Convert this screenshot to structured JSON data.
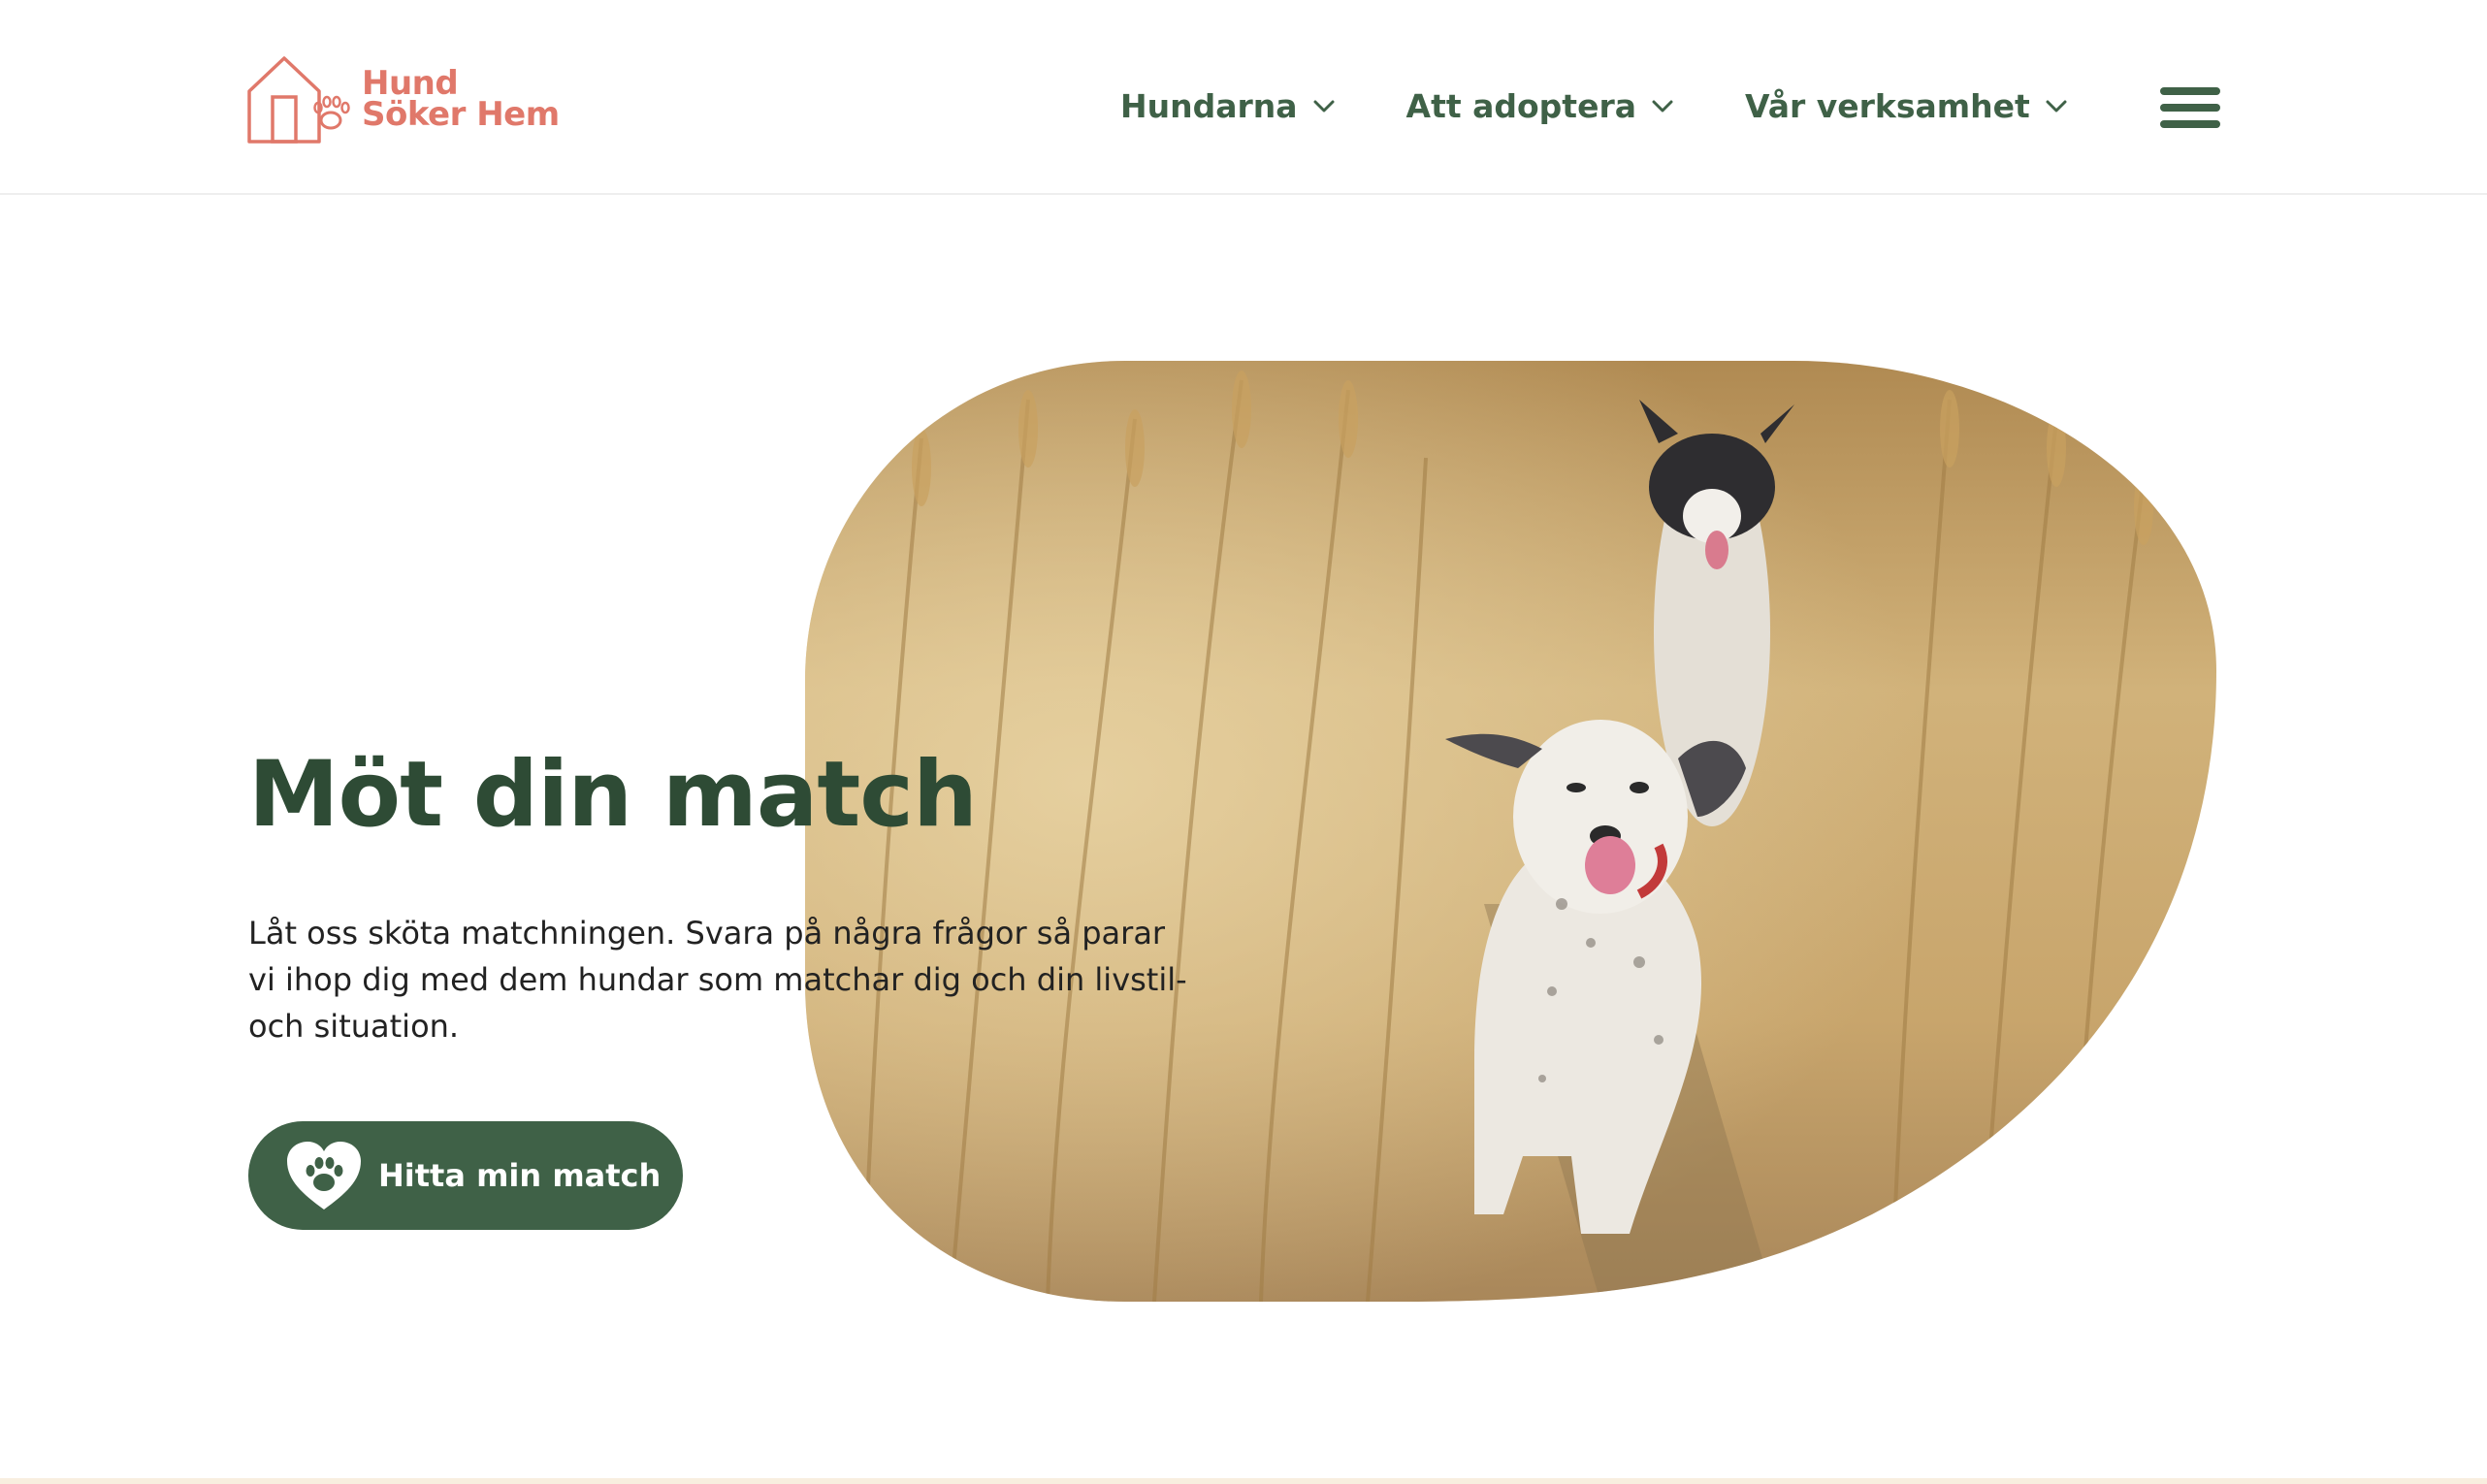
{
  "brand": {
    "line1": "Hund",
    "line2": "Söker Hem",
    "color": "#E0786A"
  },
  "nav": {
    "items": [
      {
        "label": "Hundarna",
        "icon": "chevron-down-icon"
      },
      {
        "label": "Att adoptera",
        "icon": "chevron-down-icon"
      },
      {
        "label": "Vår verksamhet",
        "icon": "chevron-down-icon"
      }
    ],
    "menu_icon": "hamburger-menu-icon",
    "color": "#3F6147"
  },
  "hero": {
    "title": "Möt din match",
    "text": "Låt oss sköta matchningen. Svara på några frågor så parar vi ihop dig med dem hundar som matchar dig och din livstil- och situation.",
    "cta_label": "Hitta min match",
    "cta_icon": "heart-paw-icon",
    "image": "two dogs running through a wheat field",
    "title_color": "#2E4B35",
    "button_color": "#3F6147"
  }
}
